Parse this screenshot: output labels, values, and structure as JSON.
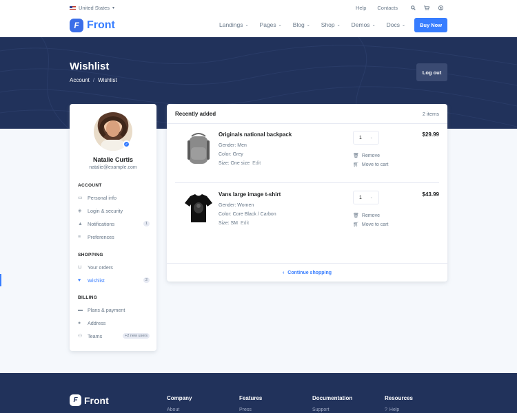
{
  "topbar": {
    "locale": "United States",
    "help": "Help",
    "contacts": "Contacts",
    "icons": [
      "search-icon",
      "cart-icon",
      "user-icon"
    ]
  },
  "nav": {
    "logo_text": "Front",
    "links": [
      "Landings",
      "Pages",
      "Blog",
      "Shop",
      "Demos",
      "Docs"
    ],
    "cta": "Buy Now"
  },
  "hero": {
    "title": "Wishlist",
    "breadcrumb": [
      "Account",
      "/",
      "Wishlist"
    ],
    "logout": "Log out"
  },
  "profile": {
    "name": "Natalie Curtis",
    "email": "natalie@example.com"
  },
  "sidebar": {
    "sections": [
      {
        "title": "ACCOUNT",
        "items": [
          {
            "label": "Personal info",
            "icon": "id-card-icon"
          },
          {
            "label": "Login & security",
            "icon": "shield-icon"
          },
          {
            "label": "Notifications",
            "icon": "bell-icon",
            "badge": "1"
          },
          {
            "label": "Preferences",
            "icon": "sliders-icon"
          }
        ]
      },
      {
        "title": "SHOPPING",
        "items": [
          {
            "label": "Your orders",
            "icon": "basket-icon"
          },
          {
            "label": "Wishlist",
            "icon": "heart-icon",
            "badge": "2",
            "active": true
          }
        ]
      },
      {
        "title": "BILLING",
        "items": [
          {
            "label": "Plans & payment",
            "icon": "credit-card-icon"
          },
          {
            "label": "Address",
            "icon": "map-pin-icon"
          },
          {
            "label": "Teams",
            "icon": "people-icon",
            "badge": "+2 new users"
          }
        ]
      }
    ]
  },
  "wishlist": {
    "title": "Recently added",
    "count": "2 items",
    "items": [
      {
        "name": "Originals national backpack",
        "gender": "Gender: Men",
        "color": "Color: Grey",
        "size": "Size: One size",
        "edit": "Edit",
        "qty": "1",
        "remove": "Remove",
        "move": "Move to cart",
        "price": "$29.99"
      },
      {
        "name": "Vans large image t-shirt",
        "gender": "Gender: Women",
        "color": "Color: Core Black / Carbon",
        "size": "Size: SM",
        "edit": "Edit",
        "qty": "1",
        "remove": "Remove",
        "move": "Move to cart",
        "price": "$43.99"
      }
    ],
    "continue": "Continue shopping"
  },
  "footer": {
    "logo_text": "Front",
    "columns": [
      {
        "title": "Company",
        "link": "About"
      },
      {
        "title": "Features",
        "link": "Press"
      },
      {
        "title": "Documentation",
        "link": "Support"
      },
      {
        "title": "Resources",
        "link": "Help"
      }
    ]
  },
  "colors": {
    "primary": "#377dff",
    "hero_bg": "#21325b",
    "page_bg": "#f5f8fc",
    "text": "#1e2022",
    "muted": "#677788"
  }
}
